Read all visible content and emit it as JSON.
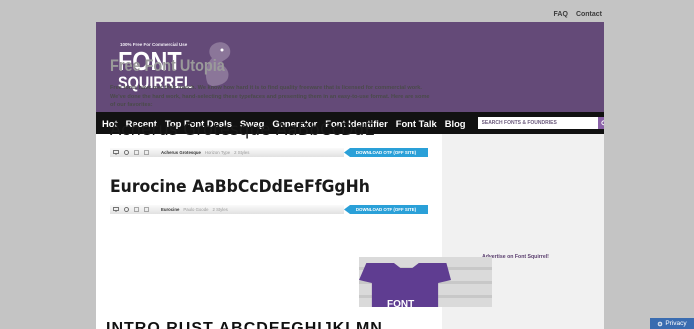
{
  "top_links": [
    "FAQ",
    "Contact"
  ],
  "logo": {
    "tagline": "100% Free For Commercial Use",
    "word1": "FONT",
    "word2": "SQUIRREL"
  },
  "nav": {
    "items": [
      "Hot",
      "Recent",
      "Top Font Deals",
      "Swag",
      "Generator",
      "Font Identifier",
      "Font Talk",
      "Blog"
    ],
    "search_placeholder": "SEARCH FONTS & FOUNDRIES"
  },
  "main": {
    "title": "Free Font Utopia",
    "intro": "Free fonts have met their match. We know how hard it is to find quality freeware that is licensed for commercial work. We've done the hard work, hand-selecting these typefaces and presenting them in an easy-to-use format. Here are some of our favorites:",
    "fonts": [
      {
        "sample": "Acherus Grotesque AaBbCcDdE",
        "name": "Acherus Grotesque",
        "foundry": "Horizon Type",
        "styles": "2 Styles",
        "download": "DOWNLOAD OTF (OFF SITE)"
      },
      {
        "sample": "Eurocine AaBbCcDdEeFfGgHh",
        "name": "Eurocine",
        "foundry": "Paulo Goode",
        "styles": "2 Styles",
        "download": "DOWNLOAD OTF (OFF SITE)"
      }
    ],
    "partial_sample": "INTRO RUST ABCDEFGHIJKLMN"
  },
  "sidebar": {
    "ad_label": "Advertise on Font Squirrel!",
    "shirt_text": "FONT"
  },
  "privacy": "Privacy",
  "colors": {
    "header_bg": "#644a78",
    "nav_bg": "#111111",
    "download_blue": "#2aa0d8",
    "search_btn": "#8a62a8"
  }
}
